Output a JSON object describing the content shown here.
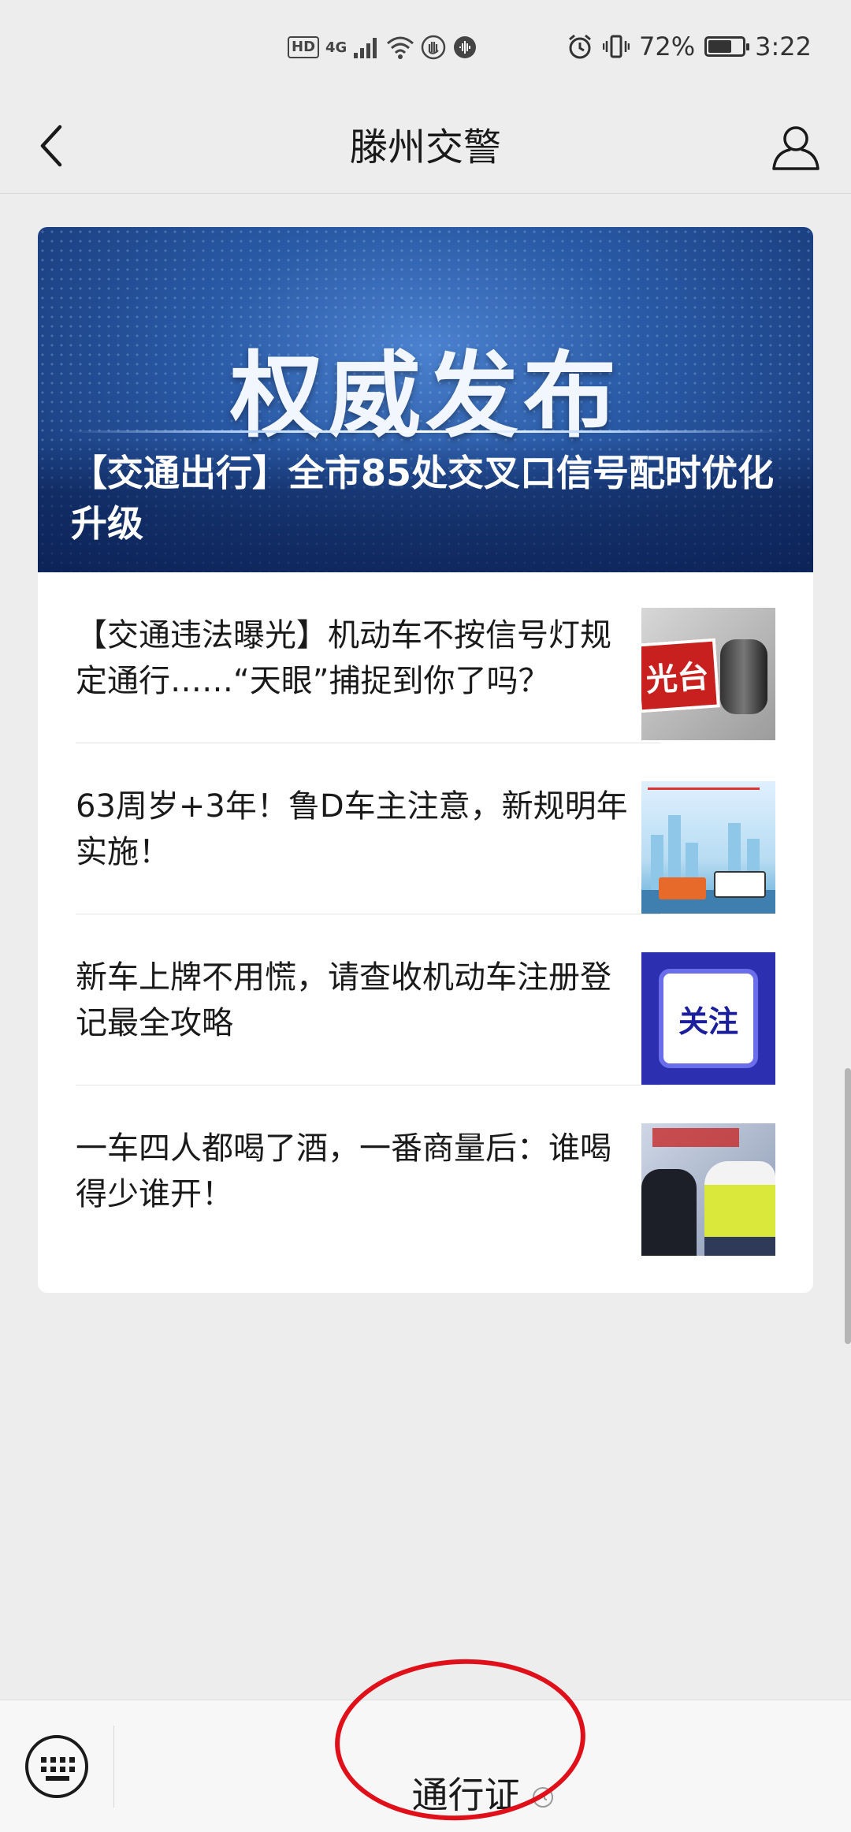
{
  "status_bar": {
    "hd": "HD",
    "network": "4G",
    "battery": "72%",
    "battery_level": 0.72,
    "time": "3:22"
  },
  "header": {
    "title": "滕州交警",
    "back_icon": "chevron-left-icon",
    "profile_icon": "person-icon"
  },
  "banner": {
    "heading": "权威发布",
    "title": "【交通出行】全市85处交叉口信号配时优化升级"
  },
  "news": [
    {
      "title": "【交通违法曝光】机动车不按信号灯规定通行……“天眼”捕捉到你了吗？",
      "thumb_text": "光台"
    },
    {
      "title": "63周岁+3年！鲁D车主注意，新规明年实施！",
      "thumb_text": ""
    },
    {
      "title": "新车上牌不用慌，请查收机动车注册登记最全攻略",
      "thumb_text": "关注"
    },
    {
      "title": "一车四人都喝了酒，一番商量后：谁喝得少谁开！",
      "thumb_text": ""
    }
  ],
  "bottom_menu": {
    "keyboard_icon": "keyboard-icon",
    "item_label": "通行证",
    "item_icon": "mini-program-icon"
  },
  "colors": {
    "background": "#ededed",
    "card": "#ffffff",
    "annotation": "#e0101a",
    "banner": "#2a5aa6"
  }
}
